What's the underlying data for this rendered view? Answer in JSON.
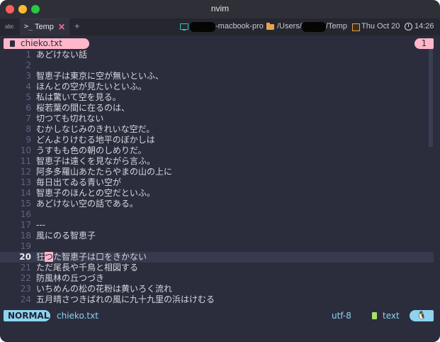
{
  "window": {
    "title": "nvim"
  },
  "tabbar": {
    "input_indicator": "abc",
    "tab_prompt": ">_",
    "tab_label": "Temp",
    "tab_close": "✕",
    "new_tab": "+",
    "host_suffix": "-macbook-pro",
    "path_prefix": "/Users/",
    "path_suffix": "/Temp",
    "date": "Thu Oct 20",
    "time": "14:26"
  },
  "buffer_tab": {
    "filename": "chieko.txt",
    "count": "1"
  },
  "current_line": 20,
  "cursor_char": "つ",
  "lines": [
    {
      "n": "1",
      "text": "あどけない話"
    },
    {
      "n": "2",
      "text": ""
    },
    {
      "n": "3",
      "text": "智恵子は東京に空が無いといふ、"
    },
    {
      "n": "4",
      "text": "ほんとの空が見たいといふ。"
    },
    {
      "n": "5",
      "text": "私は驚いて空を見る。"
    },
    {
      "n": "6",
      "text": "桜若葉の間に在るのは、"
    },
    {
      "n": "7",
      "text": "切つても切れない"
    },
    {
      "n": "8",
      "text": "むかしなじみのきれいな空だ。"
    },
    {
      "n": "9",
      "text": "どんよりけむる地平のぼかしは"
    },
    {
      "n": "10",
      "text": "うすもも色の朝のしめりだ。"
    },
    {
      "n": "11",
      "text": "智恵子は遠くを見ながら言ふ。"
    },
    {
      "n": "12",
      "text": "阿多多羅山あたたらやまの山の上に"
    },
    {
      "n": "13",
      "text": "毎日出てゐる青い空が"
    },
    {
      "n": "14",
      "text": "智恵子のほんとの空だといふ。"
    },
    {
      "n": "15",
      "text": "あどけない空の話である。"
    },
    {
      "n": "16",
      "text": ""
    },
    {
      "n": "17",
      "text": "---"
    },
    {
      "n": "18",
      "text": "風にのる智恵子"
    },
    {
      "n": "19",
      "text": ""
    },
    {
      "n": "20",
      "text_before": "狂",
      "text_after": "た智恵子は口をきかない"
    },
    {
      "n": "21",
      "text": "ただ尾長や千鳥と相図する"
    },
    {
      "n": "22",
      "text": "防風林の丘つづき"
    },
    {
      "n": "23",
      "text": "いちめんの松の花粉は黄いろく流れ"
    },
    {
      "n": "24",
      "text": "五月晴さつきばれの風に九十九里の浜はけむる"
    }
  ],
  "statusline": {
    "mode": "NORMAL",
    "filename": "chieko.txt",
    "encoding": "utf-8",
    "filetype": "text",
    "os_icon": "🐧"
  },
  "colors": {
    "background": "#2b2d3d",
    "accent_pink": "#ffb7c9",
    "accent_blue": "#8fd3f0",
    "line_number": "#5f6380"
  }
}
